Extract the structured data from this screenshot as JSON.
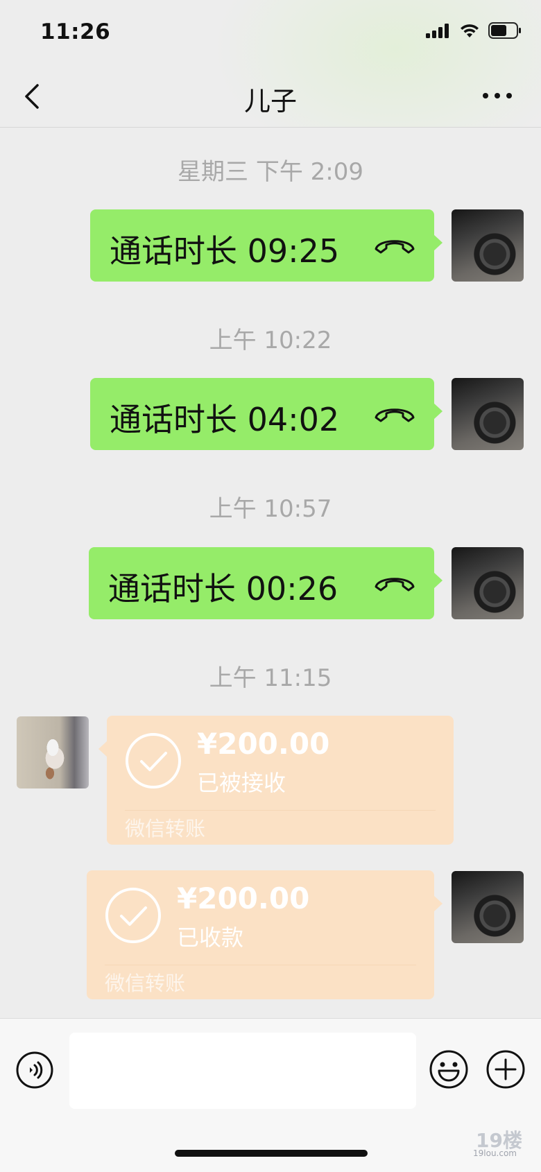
{
  "status_bar": {
    "time": "11:26"
  },
  "nav": {
    "title": "儿子"
  },
  "messages": {
    "t1": "星期三 下午 2:09",
    "call1": "通话时长 09:25",
    "t2": "上午 10:22",
    "call2": "通话时长 04:02",
    "t3": "上午 10:57",
    "call3": "通话时长 00:26",
    "t4": "上午 11:15",
    "transfer1": {
      "amount": "¥200.00",
      "status": "已被接收",
      "footer": "微信转账"
    },
    "transfer2": {
      "amount": "¥200.00",
      "status": "已收款",
      "footer": "微信转账"
    }
  },
  "input": {
    "value": "",
    "placeholder": ""
  },
  "icons": {
    "back": "chevron-left-icon",
    "more": "more-dots-icon",
    "call": "phone-hangup-icon",
    "check": "check-circle-icon",
    "voice": "voice-icon",
    "emoji": "emoji-icon",
    "plus": "plus-circle-icon"
  },
  "colors": {
    "background": "#ededed",
    "sent_bubble": "#95ec69",
    "transfer_bubble": "#fbe1c5",
    "timestamp": "#a8a8a8"
  },
  "watermark": {
    "text": "19lou.com"
  }
}
